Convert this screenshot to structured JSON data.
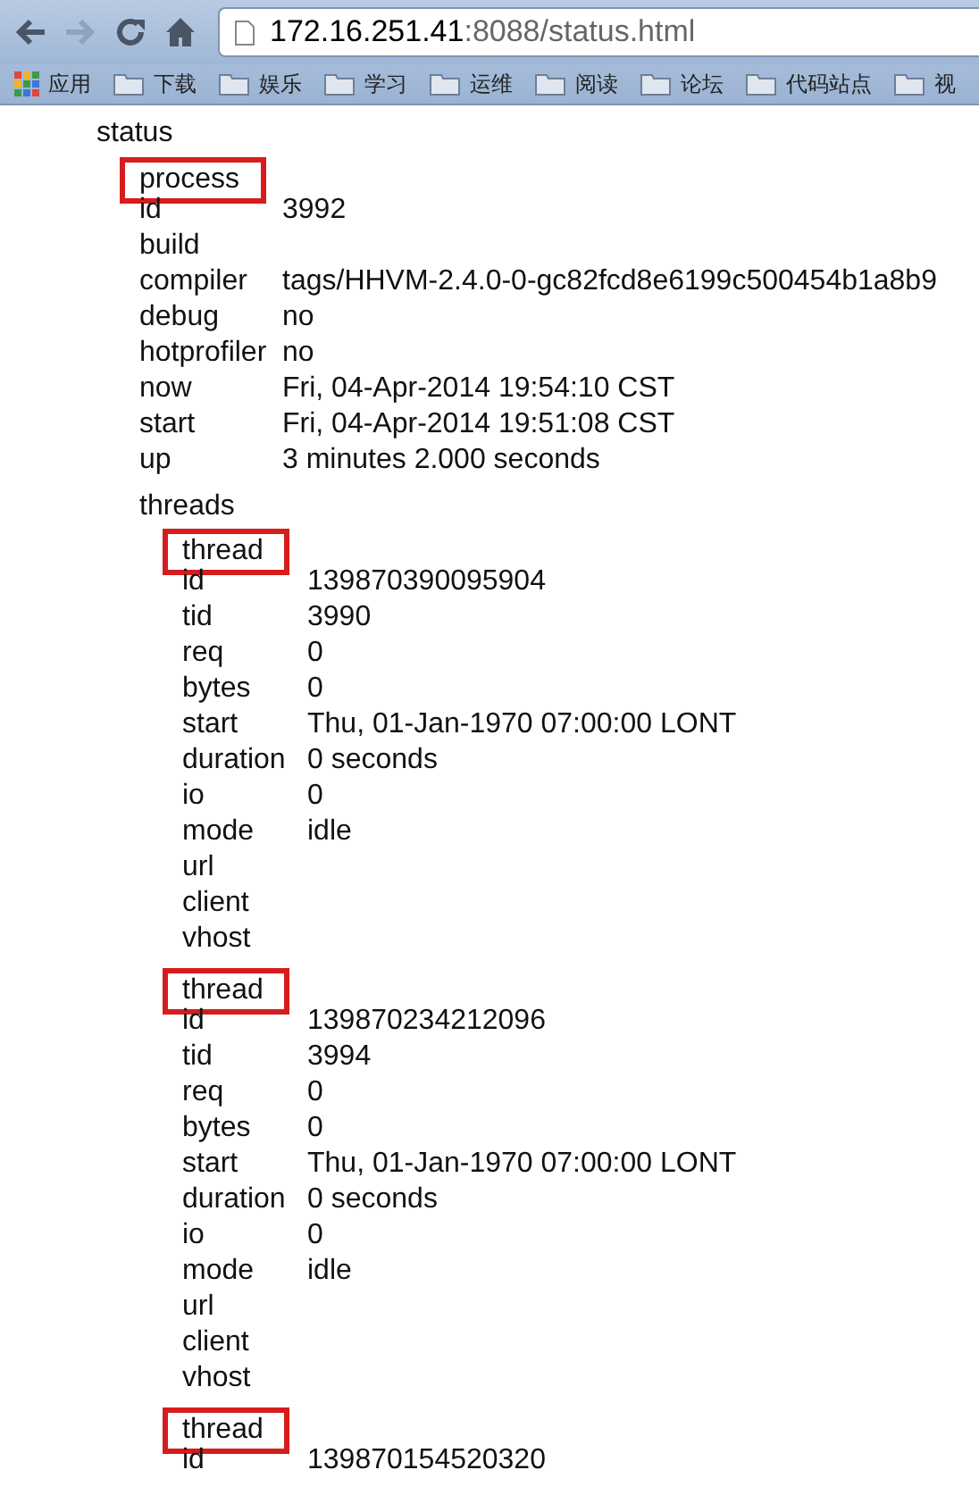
{
  "toolbar": {
    "back_disabled": false,
    "forward_disabled": true,
    "url_host": "172.16.251.41",
    "url_rest": ":8088/status.html"
  },
  "bookmarks": [
    {
      "kind": "apps",
      "label": "应用"
    },
    {
      "kind": "folder",
      "label": "下载"
    },
    {
      "kind": "folder",
      "label": "娱乐"
    },
    {
      "kind": "folder",
      "label": "学习"
    },
    {
      "kind": "folder",
      "label": "运维"
    },
    {
      "kind": "folder",
      "label": "阅读"
    },
    {
      "kind": "folder",
      "label": "论坛"
    },
    {
      "kind": "folder",
      "label": "代码站点"
    },
    {
      "kind": "folder",
      "label": "视"
    }
  ],
  "status": {
    "label": "status",
    "process": {
      "label": "process",
      "highlighted": true,
      "fields": [
        {
          "key": "id",
          "value": "3992"
        },
        {
          "key": "build"
        },
        {
          "key": "compiler",
          "value": "tags/HHVM-2.4.0-0-gc82fcd8e6199c500454b1a8b9"
        },
        {
          "key": "debug",
          "value": "no"
        },
        {
          "key": "hotprofiler",
          "value": "no"
        },
        {
          "key": "now",
          "value": "Fri, 04-Apr-2014 19:54:10 CST"
        },
        {
          "key": "start",
          "value": "Fri, 04-Apr-2014 19:51:08 CST"
        },
        {
          "key": "up",
          "value": "3 minutes 2.000 seconds"
        }
      ],
      "threads": {
        "label": "threads",
        "items": [
          {
            "label": "thread",
            "highlighted": true,
            "fields": [
              {
                "key": "id",
                "value": "139870390095904"
              },
              {
                "key": "tid",
                "value": "3990"
              },
              {
                "key": "req",
                "value": "0"
              },
              {
                "key": "bytes",
                "value": "0"
              },
              {
                "key": "start",
                "value": "Thu, 01-Jan-1970 07:00:00 LONT"
              },
              {
                "key": "duration",
                "value": "0 seconds"
              },
              {
                "key": "io",
                "value": "0"
              },
              {
                "key": "mode",
                "value": "idle"
              },
              {
                "key": "url"
              },
              {
                "key": "client"
              },
              {
                "key": "vhost"
              }
            ]
          },
          {
            "label": "thread",
            "highlighted": true,
            "fields": [
              {
                "key": "id",
                "value": "139870234212096"
              },
              {
                "key": "tid",
                "value": "3994"
              },
              {
                "key": "req",
                "value": "0"
              },
              {
                "key": "bytes",
                "value": "0"
              },
              {
                "key": "start",
                "value": "Thu, 01-Jan-1970 07:00:00 LONT"
              },
              {
                "key": "duration",
                "value": "0 seconds"
              },
              {
                "key": "io",
                "value": "0"
              },
              {
                "key": "mode",
                "value": "idle"
              },
              {
                "key": "url"
              },
              {
                "key": "client"
              },
              {
                "key": "vhost"
              }
            ]
          },
          {
            "label": "thread",
            "highlighted": true,
            "fields": [
              {
                "key": "id",
                "value": "139870154520320"
              }
            ]
          }
        ]
      }
    }
  }
}
